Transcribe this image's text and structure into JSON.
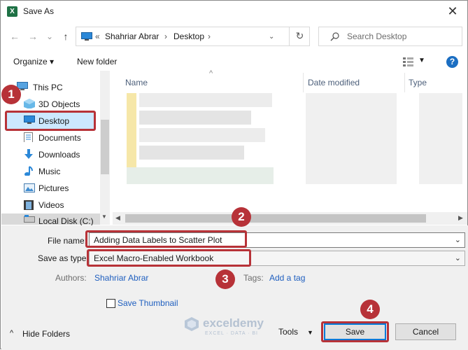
{
  "window": {
    "title": "Save As",
    "app_icon_letter": "X",
    "close_glyph": "✕"
  },
  "navigation": {
    "back_glyph": "←",
    "forward_glyph": "→",
    "recent_glyph": "⌄",
    "up_glyph": "↑",
    "address_overflow": "«",
    "path": [
      "Shahriar Abrar",
      "Desktop"
    ],
    "refresh_glyph": "↻",
    "search_placeholder": "Search Desktop"
  },
  "toolbar": {
    "organize_label": "Organize ▾",
    "new_folder_label": "New folder",
    "help_label": "?"
  },
  "sidebar": {
    "items": [
      {
        "label": "This PC"
      },
      {
        "label": "3D Objects"
      },
      {
        "label": "Desktop",
        "selected": true
      },
      {
        "label": "Documents"
      },
      {
        "label": "Downloads"
      },
      {
        "label": "Music"
      },
      {
        "label": "Pictures"
      },
      {
        "label": "Videos"
      },
      {
        "label": "Local Disk (C:)"
      }
    ]
  },
  "file_list": {
    "columns": [
      "Name",
      "Date modified",
      "Type"
    ],
    "sort_glyph": "^"
  },
  "form": {
    "file_name_label": "File name:",
    "file_name_value": "Adding Data Labels to Scatter Plot",
    "save_type_label": "Save as type:",
    "save_type_value": "Excel Macro-Enabled Workbook",
    "authors_label": "Authors:",
    "authors_value": "Shahriar Abrar",
    "tags_label": "Tags:",
    "tags_value": "Add a tag",
    "thumbnail_label": "Save Thumbnail",
    "thumbnail_checked": false
  },
  "footer": {
    "hide_folders_label": "Hide Folders",
    "tools_label": "Tools",
    "save_label": "Save",
    "cancel_label": "Cancel"
  },
  "watermark": {
    "name": "exceldemy",
    "tagline": "EXCEL · DATA · BI"
  },
  "callouts": [
    "1",
    "2",
    "3",
    "4"
  ],
  "colors": {
    "accent": "#0078d7",
    "callout_red": "#b73238",
    "link_blue": "#1f5fbf",
    "selection": "#cce8ff"
  }
}
